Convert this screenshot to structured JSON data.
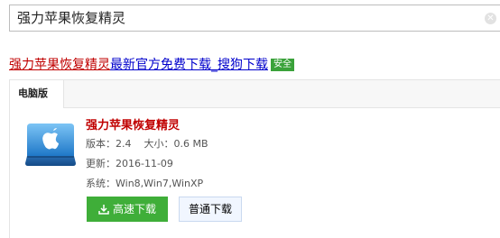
{
  "search": {
    "value": "强力苹果恢复精灵"
  },
  "result": {
    "title_red": "强力苹果恢复精灵",
    "title_blue": "最新官方免费下载_搜狗下载",
    "badge": "安全"
  },
  "card": {
    "tab_label": "电脑版",
    "app_name": "强力苹果恢复精灵",
    "version": "版本：2.4",
    "size": "大小：0.6 MB",
    "updated": "更新：2016-11-09",
    "system": "系统：Win8,Win7,WinXP",
    "fast_download": "高速下载",
    "normal_download": "普通下载"
  },
  "colors": {
    "title_red": "#c00000",
    "title_blue": "#0000cc",
    "badge_green": "#3aa23a",
    "fast_button": "#3fae39"
  },
  "icons": {
    "clear": "close-icon",
    "app": "apple-drive-icon",
    "download": "download-icon"
  }
}
